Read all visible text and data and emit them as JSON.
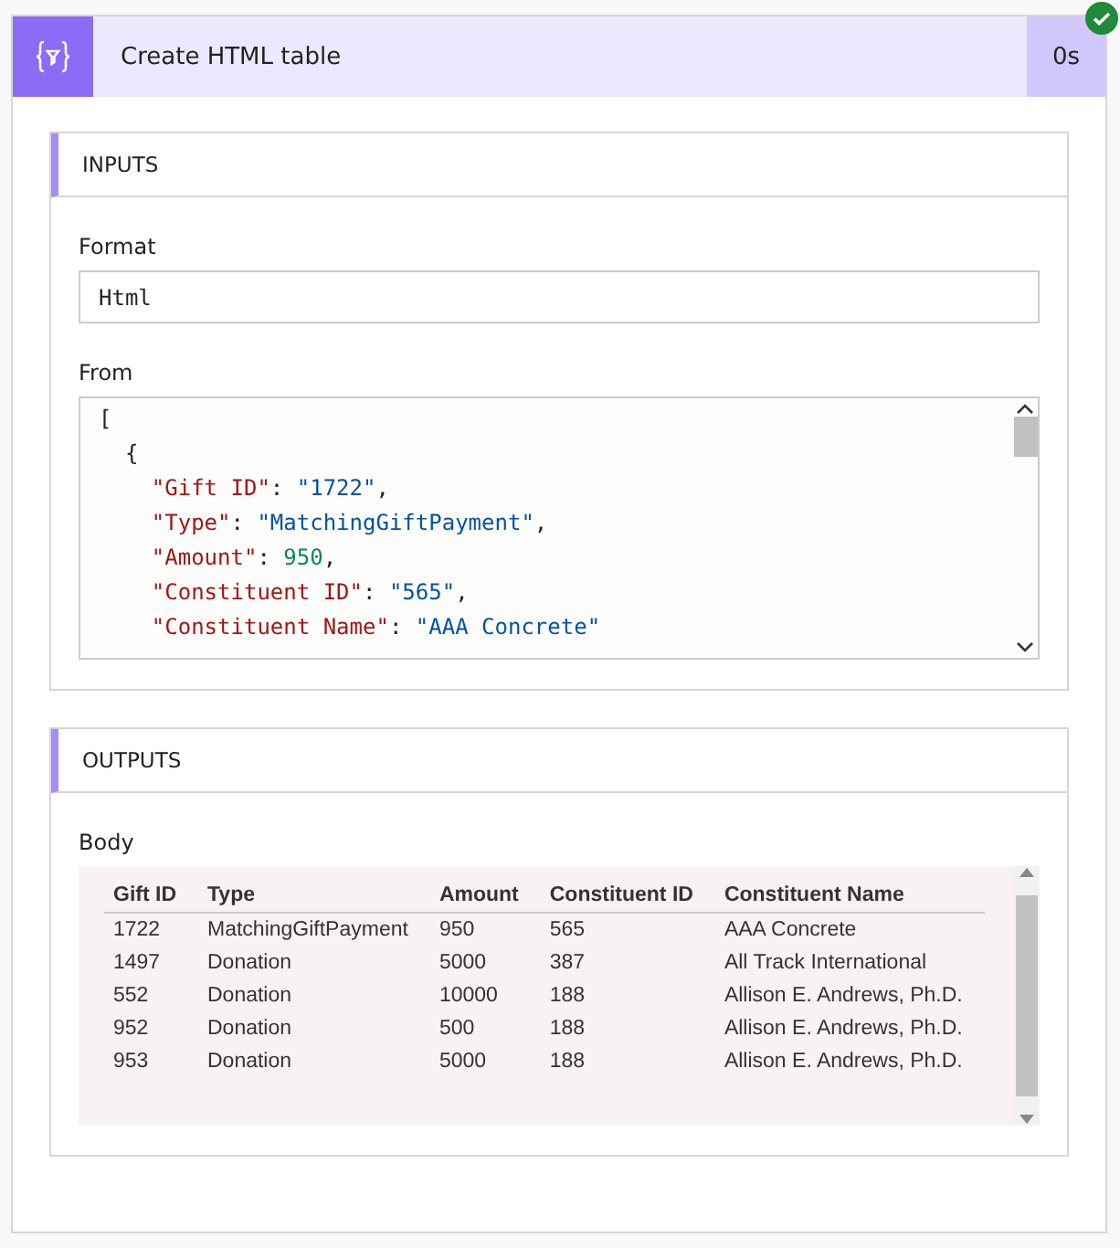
{
  "action": {
    "title": "Create HTML table",
    "duration": "0s",
    "succeeded": true
  },
  "inputs": {
    "heading": "INPUTS",
    "format": {
      "label": "Format",
      "value": "Html"
    },
    "from": {
      "label": "From",
      "lines": [
        {
          "tokens": [
            {
              "kind": "punct",
              "text": "["
            }
          ]
        },
        {
          "tokens": [
            {
              "kind": "punct",
              "text": "  {"
            }
          ]
        },
        {
          "tokens": [
            {
              "kind": "key",
              "text": "    \"Gift ID\""
            },
            {
              "kind": "punct",
              "text": ": "
            },
            {
              "kind": "string",
              "text": "\"1722\""
            },
            {
              "kind": "punct",
              "text": ","
            }
          ]
        },
        {
          "tokens": [
            {
              "kind": "key",
              "text": "    \"Type\""
            },
            {
              "kind": "punct",
              "text": ": "
            },
            {
              "kind": "string",
              "text": "\"MatchingGiftPayment\""
            },
            {
              "kind": "punct",
              "text": ","
            }
          ]
        },
        {
          "tokens": [
            {
              "kind": "key",
              "text": "    \"Amount\""
            },
            {
              "kind": "punct",
              "text": ": "
            },
            {
              "kind": "number",
              "text": "950"
            },
            {
              "kind": "punct",
              "text": ","
            }
          ]
        },
        {
          "tokens": [
            {
              "kind": "key",
              "text": "    \"Constituent ID\""
            },
            {
              "kind": "punct",
              "text": ": "
            },
            {
              "kind": "string",
              "text": "\"565\""
            },
            {
              "kind": "punct",
              "text": ","
            }
          ]
        },
        {
          "tokens": [
            {
              "kind": "key",
              "text": "    \"Constituent Name\""
            },
            {
              "kind": "punct",
              "text": ": "
            },
            {
              "kind": "string",
              "text": "\"AAA Concrete\""
            }
          ]
        }
      ]
    }
  },
  "outputs": {
    "heading": "OUTPUTS",
    "body": {
      "label": "Body",
      "columns": [
        "Gift ID",
        "Type",
        "Amount",
        "Constituent ID",
        "Constituent Name"
      ],
      "rows": [
        [
          "1722",
          "MatchingGiftPayment",
          "950",
          "565",
          "AAA Concrete"
        ],
        [
          "1497",
          "Donation",
          "5000",
          "387",
          "All Track International"
        ],
        [
          "552",
          "Donation",
          "10000",
          "188",
          "Allison E. Andrews, Ph.D."
        ],
        [
          "952",
          "Donation",
          "500",
          "188",
          "Allison E. Andrews, Ph.D."
        ],
        [
          "953",
          "Donation",
          "5000",
          "188",
          "Allison E. Andrews, Ph.D."
        ]
      ]
    }
  }
}
